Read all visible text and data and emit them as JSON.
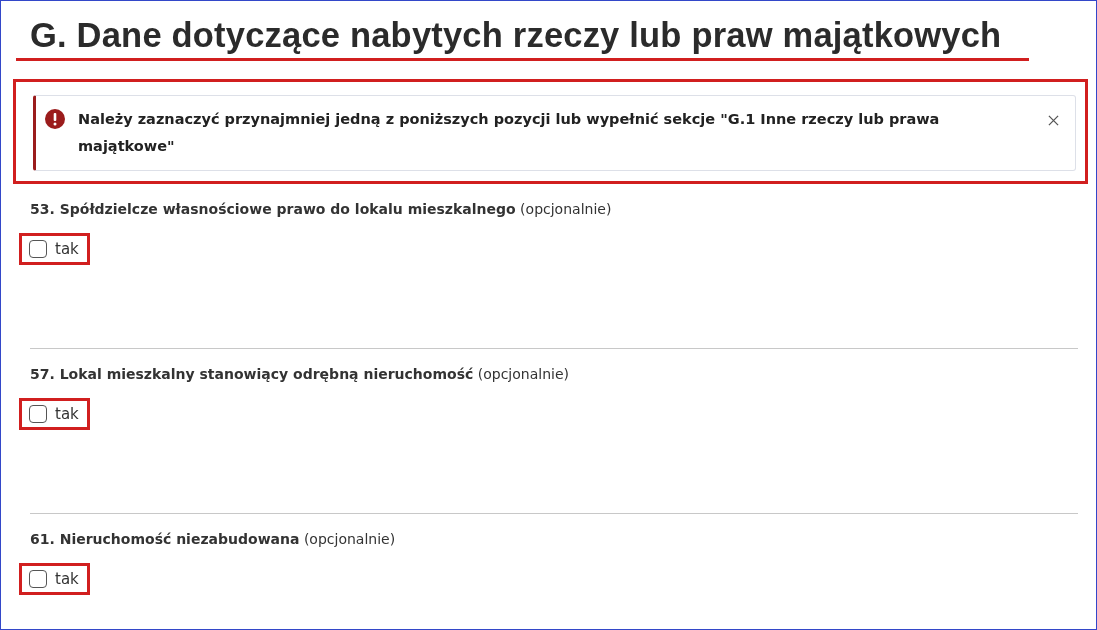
{
  "heading": {
    "text": "G. Dane dotyczące nabytych rzeczy lub praw majątkowych",
    "underlined": true
  },
  "alert": {
    "message": "Należy zaznaczyć przynajmniej jedną z poniższych pozycji lub wypełnić sekcje \"G.1 Inne rzeczy lub prawa majątkowe\"",
    "highlighted": true
  },
  "questions": [
    {
      "label": "**53. Spółdzielcze własnościowe prawo do lokalu mieszkalnego** (opcjonalnie)",
      "kind": "framed",
      "option": {
        "label": "tak",
        "checked": false
      }
    },
    {
      "label": "**57. Lokal mieszkalny stanowiący odrębną nieruchomość** (opcjonalnie)",
      "kind": "framed",
      "option": {
        "label": "tak",
        "checked": false
      }
    },
    {
      "label": "**61. Nieruchomość niezabudowana** (opcjonalnie)",
      "kind": "framed",
      "option": {
        "label": "tak",
        "checked": false
      }
    }
  ]
}
